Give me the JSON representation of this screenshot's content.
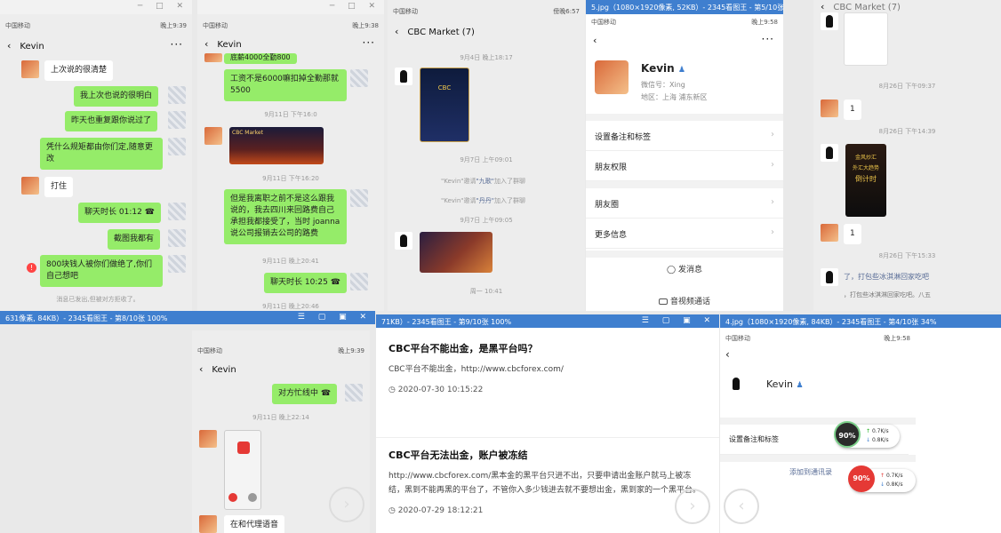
{
  "status": {
    "carrier": "中国移动",
    "t1": "晚上9:39",
    "t2": "晚上9:38",
    "t3": "傍晚6:57",
    "t4": "晚上9:58",
    "t5": "晚上9:39",
    "t6": "晚上9:58"
  },
  "win1": {
    "contact": "Kevin",
    "messages": [
      "上次说的很清楚",
      "我上次也说的很明白",
      "昨天也重复跟你说过了",
      "凭什么规矩都由你们定,随意更改",
      "打住",
      "聊天时长 01:12",
      "截图我都有",
      "800块钱人被你们做绝了,你们自己想吧"
    ],
    "footer": "消息已发出,但被对方拒收了。"
  },
  "win2": {
    "contact": "Kevin",
    "partial_top": "底薪4000全勤800",
    "messages": [
      "工资不是6000嘛扣掉全勤那就5500",
      "但是我离职之前不是这么跟我说的，我去四川来回路费自己承担我都接受了，当时 joanna说公司报销去公司的路费",
      "聊天时长 10:25"
    ],
    "times": [
      "9月11日 下午16:0",
      "9月11日 下午16:20",
      "9月11日 晚上20:41",
      "9月11日 晚上20:46"
    ],
    "img_title": "CBC Market"
  },
  "win3": {
    "title": "CBC Market (7)",
    "times": [
      "9月4日 晚上18:17",
      "9月7日 上午09:01",
      "9月7日 上午09:05",
      "周一 10:41"
    ],
    "sys1": [
      "\"Kevin\"邀请",
      "\"九歌\"",
      "加入了群聊"
    ],
    "sys2": [
      "\"Kevin\"邀请",
      "\"丹丹\"",
      "加入了群聊"
    ],
    "poster_text": "CBC"
  },
  "win4": {
    "title": "5.jpg（1080×1920像素, 52KB）- 2345看图王 - 第5/10张 34%",
    "name": "Kevin",
    "wechat_id": "微信号：Xing",
    "region": "地区：上海  浦东新区",
    "rows": [
      "设置备注和标签",
      "朋友权限",
      "朋友圈",
      "更多信息"
    ],
    "send_msg": "发消息",
    "video_call": "音视频通话"
  },
  "win5": {
    "title": "CBC Market (7)",
    "times": [
      "8月26日 下午09:37",
      "8月26日 下午14:39",
      "8月26日 下午15:33"
    ],
    "one": "1",
    "poster_lines": [
      "金风炒汇",
      "外汇大趋势",
      "倒计时"
    ],
    "tail1": "了，打包些冰淇淋回家吃吧",
    "tail2": "，打包些冰淇淋回家吃吧。八五"
  },
  "win6": {
    "title": "631像素, 84KB）- 2345看图王 - 第8/10张 100%"
  },
  "win7": {
    "contact": "Kevin",
    "messages": [
      "对方忙线中",
      "在和代理语音"
    ],
    "times": [
      "9月11日 晚上22:14"
    ]
  },
  "win8": {
    "title": "71KB）- 2345看图王 - 第9/10张 100%",
    "a1_title": "CBC平台不能出金，是黑平台吗？",
    "a1_body": "CBC平台不能出金，http://www.cbcforex.com/",
    "a1_time": "2020-07-30 10:15:22",
    "a2_title": "CBC平台无法出金，账户被冻结",
    "a2_body": "http://www.cbcforex.com/黑本金的黑平台只进不出，只要申请出金账户就马上被冻结，黑到不能再黑的平台了，不管你入多少钱进去就不要想出金，黑到家的一个黑平台。",
    "a2_time": "2020-07-29 18:12:21"
  },
  "win9": {
    "title": "4.jpg（1080×1920像素, 84KB）- 2345看图王 - 第4/10张 34%",
    "name": "Kevin",
    "row": "设置备注和标签",
    "add": "添加到通讯录",
    "gauge1": "90%",
    "gauge2": "90%",
    "up1": "0.7K/s",
    "down1": "0.8K/s",
    "up2": "0.7K/s",
    "down2": "0.8K/s"
  },
  "colors": {
    "me_bubble": "#95ec69",
    "link": "#576b95",
    "viewer_bar": "#3f7fcf"
  }
}
